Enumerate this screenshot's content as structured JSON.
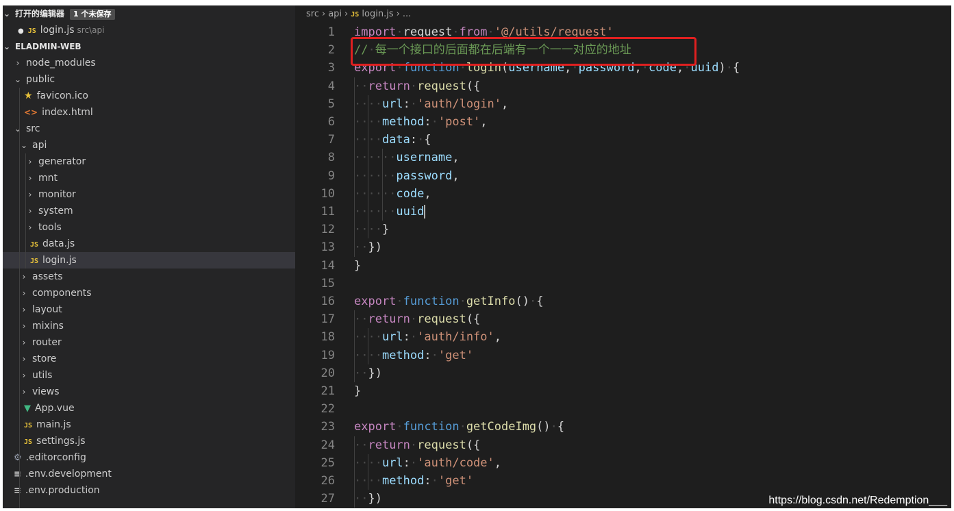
{
  "sidebar": {
    "open_editors": {
      "label": "打开的编辑器",
      "badge": "1 个未保存"
    },
    "open_file": {
      "name": "login.js",
      "path": "src\\api"
    },
    "project": "ELADMIN-WEB",
    "tree": [
      {
        "label": "node_modules",
        "kind": "folder",
        "expanded": false,
        "depth": 0
      },
      {
        "label": "public",
        "kind": "folder",
        "expanded": true,
        "depth": 0
      },
      {
        "label": "favicon.ico",
        "kind": "star",
        "depth": 1
      },
      {
        "label": "index.html",
        "kind": "html",
        "depth": 1
      },
      {
        "label": "src",
        "kind": "folder",
        "expanded": true,
        "depth": 0
      },
      {
        "label": "api",
        "kind": "folder",
        "expanded": true,
        "depth": 1
      },
      {
        "label": "generator",
        "kind": "folder",
        "expanded": false,
        "depth": 2
      },
      {
        "label": "mnt",
        "kind": "folder",
        "expanded": false,
        "depth": 2
      },
      {
        "label": "monitor",
        "kind": "folder",
        "expanded": false,
        "depth": 2
      },
      {
        "label": "system",
        "kind": "folder",
        "expanded": false,
        "depth": 2
      },
      {
        "label": "tools",
        "kind": "folder",
        "expanded": false,
        "depth": 2
      },
      {
        "label": "data.js",
        "kind": "js",
        "depth": 2
      },
      {
        "label": "login.js",
        "kind": "js",
        "depth": 2,
        "selected": true
      },
      {
        "label": "assets",
        "kind": "folder",
        "expanded": false,
        "depth": 1
      },
      {
        "label": "components",
        "kind": "folder",
        "expanded": false,
        "depth": 1
      },
      {
        "label": "layout",
        "kind": "folder",
        "expanded": false,
        "depth": 1
      },
      {
        "label": "mixins",
        "kind": "folder",
        "expanded": false,
        "depth": 1
      },
      {
        "label": "router",
        "kind": "folder",
        "expanded": false,
        "depth": 1
      },
      {
        "label": "store",
        "kind": "folder",
        "expanded": false,
        "depth": 1
      },
      {
        "label": "utils",
        "kind": "folder",
        "expanded": false,
        "depth": 1
      },
      {
        "label": "views",
        "kind": "folder",
        "expanded": false,
        "depth": 1
      },
      {
        "label": "App.vue",
        "kind": "vue",
        "depth": 1
      },
      {
        "label": "main.js",
        "kind": "js",
        "depth": 1
      },
      {
        "label": "settings.js",
        "kind": "js",
        "depth": 1
      },
      {
        "label": ".editorconfig",
        "kind": "config",
        "depth": 0
      },
      {
        "label": ".env.development",
        "kind": "text",
        "depth": 0
      },
      {
        "label": ".env.production",
        "kind": "text",
        "depth": 0
      }
    ]
  },
  "breadcrumb": [
    "src",
    "api",
    "login.js",
    "..."
  ],
  "code": [
    [
      [
        "kw",
        "import"
      ],
      [
        "ws",
        "·"
      ],
      [
        "plain",
        "request"
      ],
      [
        "ws",
        "·"
      ],
      [
        "kw",
        "from"
      ],
      [
        "ws",
        "·"
      ],
      [
        "str",
        "'@/utils/request'"
      ]
    ],
    [
      [
        "cm",
        "//"
      ],
      [
        "ws",
        "·"
      ],
      [
        "cm",
        "每一个接口的后面都在后端有一个一一对应的地址"
      ]
    ],
    [
      [
        "kw",
        "export"
      ],
      [
        "ws",
        "·"
      ],
      [
        "kwb",
        "function"
      ],
      [
        "ws",
        "·"
      ],
      [
        "fn",
        "login"
      ],
      [
        "plain",
        "("
      ],
      [
        "prop",
        "username"
      ],
      [
        "plain",
        ","
      ],
      [
        "ws",
        "·"
      ],
      [
        "prop",
        "password"
      ],
      [
        "plain",
        ","
      ],
      [
        "ws",
        "·"
      ],
      [
        "prop",
        "code"
      ],
      [
        "plain",
        ","
      ],
      [
        "ws",
        "·"
      ],
      [
        "prop",
        "uuid"
      ],
      [
        "plain",
        ")"
      ],
      [
        "ws",
        "·"
      ],
      [
        "plain",
        "{"
      ]
    ],
    [
      [
        "ws",
        "··"
      ],
      [
        "kw",
        "return"
      ],
      [
        "ws",
        "·"
      ],
      [
        "fn",
        "request"
      ],
      [
        "plain",
        "({"
      ]
    ],
    [
      [
        "ws",
        "····"
      ],
      [
        "prop",
        "url"
      ],
      [
        "plain",
        ":"
      ],
      [
        "ws",
        "·"
      ],
      [
        "str",
        "'auth/login'"
      ],
      [
        "plain",
        ","
      ]
    ],
    [
      [
        "ws",
        "····"
      ],
      [
        "prop",
        "method"
      ],
      [
        "plain",
        ":"
      ],
      [
        "ws",
        "·"
      ],
      [
        "str",
        "'post'"
      ],
      [
        "plain",
        ","
      ]
    ],
    [
      [
        "ws",
        "····"
      ],
      [
        "prop",
        "data"
      ],
      [
        "plain",
        ":"
      ],
      [
        "ws",
        "·"
      ],
      [
        "plain",
        "{"
      ]
    ],
    [
      [
        "ws",
        "······"
      ],
      [
        "prop",
        "username"
      ],
      [
        "plain",
        ","
      ]
    ],
    [
      [
        "ws",
        "······"
      ],
      [
        "prop",
        "password"
      ],
      [
        "plain",
        ","
      ]
    ],
    [
      [
        "ws",
        "······"
      ],
      [
        "prop",
        "code"
      ],
      [
        "plain",
        ","
      ]
    ],
    [
      [
        "ws",
        "······"
      ],
      [
        "prop",
        "uuid"
      ]
    ],
    [
      [
        "ws",
        "····"
      ],
      [
        "plain",
        "}"
      ]
    ],
    [
      [
        "ws",
        "··"
      ],
      [
        "plain",
        "})"
      ]
    ],
    [
      [
        "plain",
        "}"
      ]
    ],
    [],
    [
      [
        "kw",
        "export"
      ],
      [
        "ws",
        "·"
      ],
      [
        "kwb",
        "function"
      ],
      [
        "ws",
        "·"
      ],
      [
        "fn",
        "getInfo"
      ],
      [
        "plain",
        "()"
      ],
      [
        "ws",
        "·"
      ],
      [
        "plain",
        "{"
      ]
    ],
    [
      [
        "ws",
        "··"
      ],
      [
        "kw",
        "return"
      ],
      [
        "ws",
        "·"
      ],
      [
        "fn",
        "request"
      ],
      [
        "plain",
        "({"
      ]
    ],
    [
      [
        "ws",
        "····"
      ],
      [
        "prop",
        "url"
      ],
      [
        "plain",
        ":"
      ],
      [
        "ws",
        "·"
      ],
      [
        "str",
        "'auth/info'"
      ],
      [
        "plain",
        ","
      ]
    ],
    [
      [
        "ws",
        "····"
      ],
      [
        "prop",
        "method"
      ],
      [
        "plain",
        ":"
      ],
      [
        "ws",
        "·"
      ],
      [
        "str",
        "'get'"
      ]
    ],
    [
      [
        "ws",
        "··"
      ],
      [
        "plain",
        "})"
      ]
    ],
    [
      [
        "plain",
        "}"
      ]
    ],
    [],
    [
      [
        "kw",
        "export"
      ],
      [
        "ws",
        "·"
      ],
      [
        "kwb",
        "function"
      ],
      [
        "ws",
        "·"
      ],
      [
        "fn",
        "getCodeImg"
      ],
      [
        "plain",
        "()"
      ],
      [
        "ws",
        "·"
      ],
      [
        "plain",
        "{"
      ]
    ],
    [
      [
        "ws",
        "··"
      ],
      [
        "kw",
        "return"
      ],
      [
        "ws",
        "·"
      ],
      [
        "fn",
        "request"
      ],
      [
        "plain",
        "({"
      ]
    ],
    [
      [
        "ws",
        "····"
      ],
      [
        "prop",
        "url"
      ],
      [
        "plain",
        ":"
      ],
      [
        "ws",
        "·"
      ],
      [
        "str",
        "'auth/code'"
      ],
      [
        "plain",
        ","
      ]
    ],
    [
      [
        "ws",
        "····"
      ],
      [
        "prop",
        "method"
      ],
      [
        "plain",
        ":"
      ],
      [
        "ws",
        "·"
      ],
      [
        "str",
        "'get'"
      ]
    ],
    [
      [
        "ws",
        "··"
      ],
      [
        "plain",
        "})"
      ]
    ]
  ],
  "watermark": "https://blog.csdn.net/Redemption___",
  "colors": {
    "highlight_box": "#e02020",
    "editor_bg": "#1e1e1e",
    "sidebar_bg": "#252526"
  }
}
